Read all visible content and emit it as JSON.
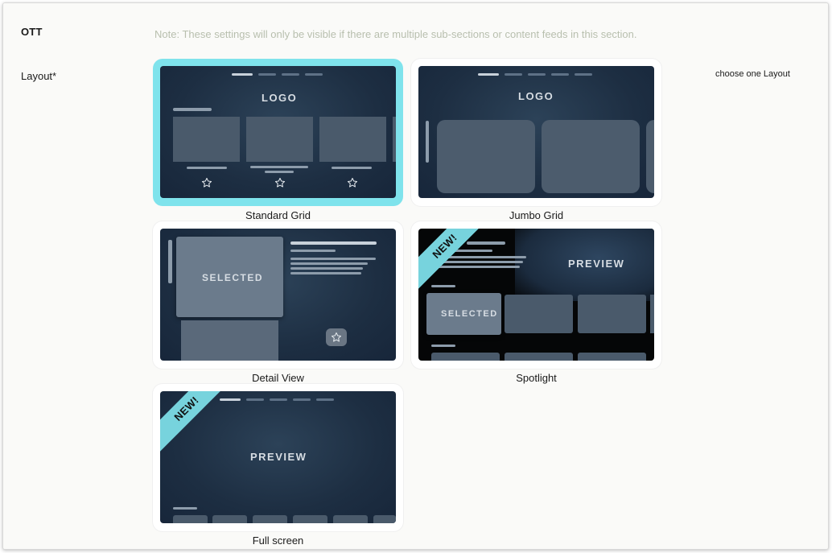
{
  "section": {
    "title": "OTT",
    "note": "Note: These settings will only be visible if there are multiple sub-sections or content feeds in this section."
  },
  "layout_field": {
    "label": "Layout*",
    "hint": "choose one Layout",
    "selected": "Standard Grid"
  },
  "options": [
    {
      "name": "Standard Grid",
      "logo": "LOGO"
    },
    {
      "name": "Jumbo Grid",
      "logo": "LOGO"
    },
    {
      "name": "Detail View",
      "tile_text": "SELECTED"
    },
    {
      "name": "Spotlight",
      "badge": "NEW!",
      "preview": "PREVIEW",
      "tile_text": "SELECTED"
    },
    {
      "name": "Full screen",
      "badge": "NEW!",
      "preview": "PREVIEW"
    }
  ],
  "icons": {
    "favorite": "star-icon"
  },
  "colors": {
    "selected_outline": "#7fe3ec",
    "ribbon": "#77d3dd",
    "thumb_bg": "#1d2e42",
    "note_text": "#b8bfae"
  }
}
